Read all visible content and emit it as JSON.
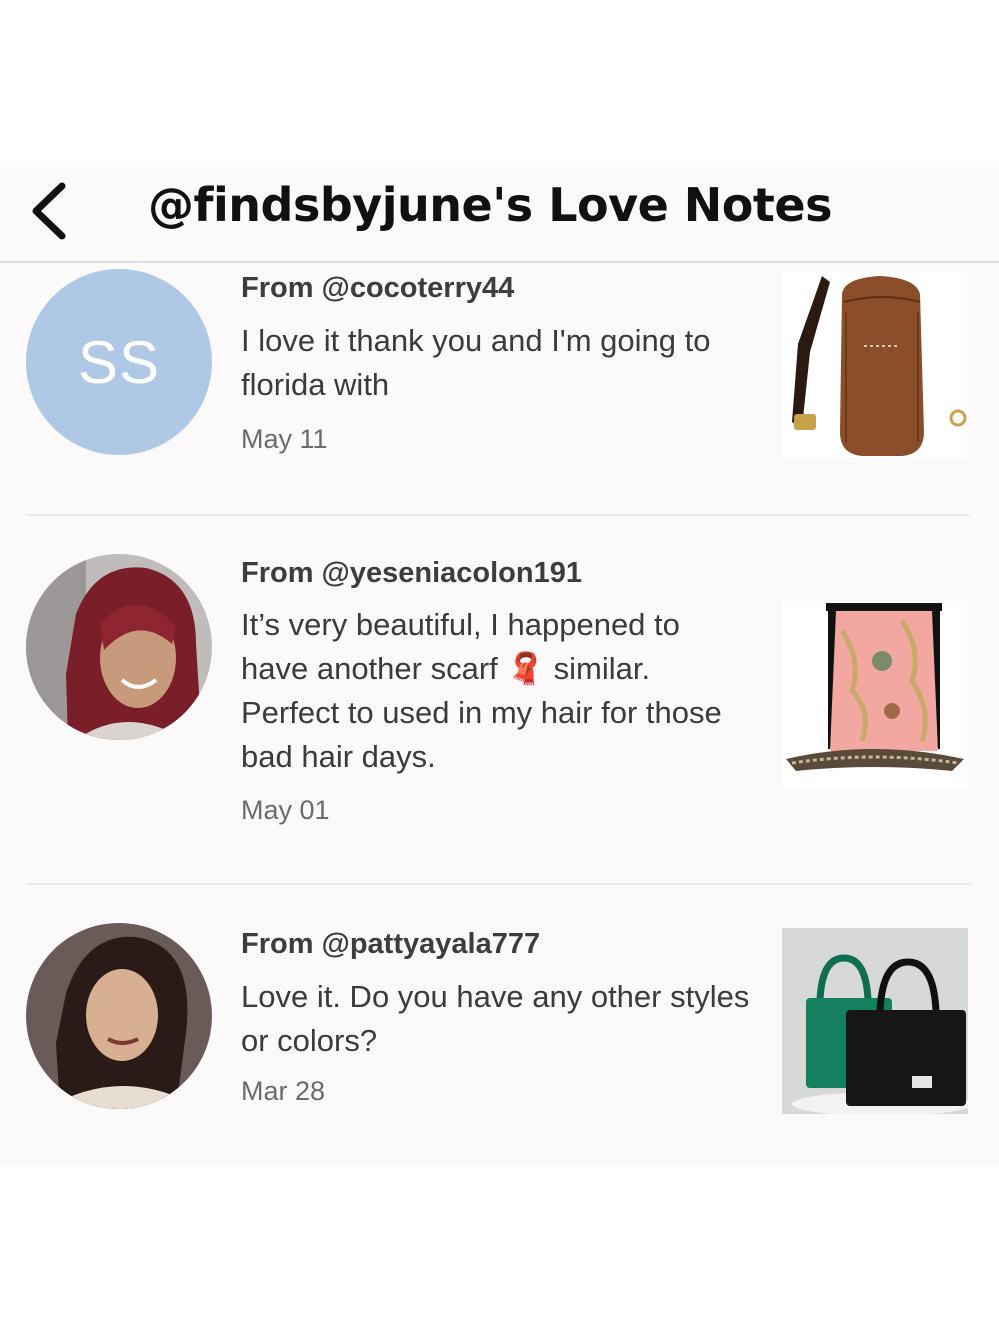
{
  "header": {
    "title": "@findsbyjune's Love Notes"
  },
  "notes": [
    {
      "avatar_initials": "SS",
      "from": "From @cocoterry44",
      "message": "I love it thank you and I'm going to florida with",
      "date": "May 11",
      "product_icon": "sling-bag-icon"
    },
    {
      "from": "From @yeseniacolon191",
      "message_before_emoji": "It’s very beautiful, I happened to have another scarf",
      "emoji": "🧣",
      "message_after_emoji": "similar. Perfect to used in my hair for those bad hair days.",
      "date": "May 01",
      "product_icon": "scarf-icon"
    },
    {
      "from": "From @pattyayala777",
      "message": "Love it. Do you have any other styles or colors?",
      "date": "Mar 28",
      "product_icon": "tote-bags-icon"
    }
  ],
  "colors": {
    "panel_bg": "#fbf9fa",
    "avatar_initials_bg": "#aec8e6",
    "text": "#3b3b3b"
  }
}
